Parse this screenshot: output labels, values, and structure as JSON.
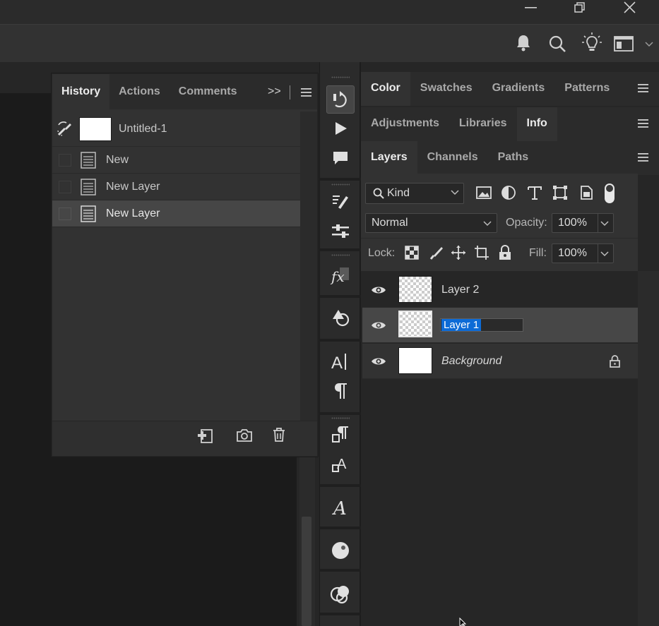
{
  "window": {
    "controls": [
      "minimize",
      "restore",
      "close"
    ]
  },
  "options_bar": {
    "icons": [
      "bell-icon",
      "search-icon",
      "lightbulb-icon",
      "workspace-icon"
    ]
  },
  "history_panel": {
    "tabs": [
      {
        "label": "History",
        "active": true
      },
      {
        "label": "Actions",
        "active": false
      },
      {
        "label": "Comments",
        "active": false
      }
    ],
    "overflow_label": ">>",
    "snapshot": {
      "name": "Untitled-1"
    },
    "items": [
      {
        "label": "New",
        "selected": false
      },
      {
        "label": "New Layer",
        "selected": false
      },
      {
        "label": "New Layer",
        "selected": true
      }
    ],
    "footer_icons": [
      "new-document-from-state-icon",
      "camera-icon",
      "trash-icon"
    ]
  },
  "dock_collapse": {
    "left": "<<",
    "right": ">>"
  },
  "tool_column": {
    "tools": [
      "history-brush-icon",
      "play-icon",
      "comment-icon",
      "brush-settings-icon",
      "adjustments-sliders-icon",
      "fx-icon",
      "shapes-icon",
      "character-icon",
      "paragraph-icon",
      "paragraph-styles-icon",
      "character-styles-icon",
      "glyphs-icon",
      "sphere-icon",
      "color-circles-icon"
    ],
    "fx_label": "fx"
  },
  "color_group": {
    "tabs": [
      {
        "label": "Color",
        "active": true
      },
      {
        "label": "Swatches",
        "active": false
      },
      {
        "label": "Gradients",
        "active": false
      },
      {
        "label": "Patterns",
        "active": false
      }
    ]
  },
  "adjust_group": {
    "tabs": [
      {
        "label": "Adjustments",
        "active": false
      },
      {
        "label": "Libraries",
        "active": false
      },
      {
        "label": "Info",
        "active": true
      }
    ]
  },
  "layers_group": {
    "tabs": [
      {
        "label": "Layers",
        "active": true
      },
      {
        "label": "Channels",
        "active": false
      },
      {
        "label": "Paths",
        "active": false
      }
    ]
  },
  "layers_panel": {
    "filter_kind": "Kind",
    "blend_mode": "Normal",
    "opacity_label": "Opacity:",
    "opacity_value": "100%",
    "lock_label": "Lock:",
    "fill_label": "Fill:",
    "fill_value": "100%",
    "layers": [
      {
        "name": "Layer 2",
        "thumb": "transparent",
        "selected": false,
        "visible": true
      },
      {
        "name": "Layer 1",
        "thumb": "transparent",
        "selected": true,
        "visible": true,
        "renaming": true
      },
      {
        "name": "Background",
        "thumb": "white",
        "selected": false,
        "visible": true,
        "locked": true
      }
    ]
  },
  "colors": {
    "selection_blue": "#0d6bd6",
    "panel_bg": "#323232"
  }
}
